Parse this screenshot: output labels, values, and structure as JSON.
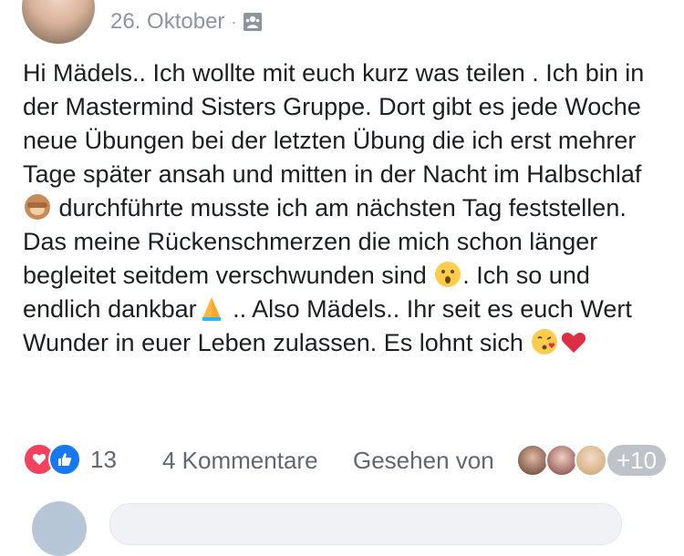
{
  "post": {
    "date": "26. Oktober",
    "separator": "·",
    "audience_icon": "group-photo-icon",
    "text_parts": [
      "Hi Mädels.. Ich wollte mit euch kurz was teilen . Ich bin in der Mastermind Sisters Gruppe. Dort gibt es jede Woche neue Übungen bei der letzten Übung die ich erst mehrer Tage später ansah und mitten in der Nacht im Halbschlaf ",
      " durchführte musste ich am nächsten Tag feststellen. Das meine Rückenschmerzen die mich schon länger begleitet seitdem verschwunden sind ",
      ". Ich so und endlich dankbar",
      " .. Also Mädels.. Ihr seit es euch Wert Wunder in euer Leben zulassen. Es lohnt sich "
    ],
    "emojis": [
      "see-no-evil-monkey",
      "hushed-face",
      "folded-hands",
      "face-blowing-kiss",
      "red-heart"
    ]
  },
  "footer": {
    "reactions": [
      "love",
      "like"
    ],
    "reaction_count": "13",
    "comments": "4 Kommentare",
    "seen_by_label": "Gesehen von",
    "seen_more": "+10"
  },
  "colors": {
    "love": "#f3425f",
    "like": "#1877f2",
    "meta_text": "#8d949e",
    "footer_text": "#606770"
  }
}
